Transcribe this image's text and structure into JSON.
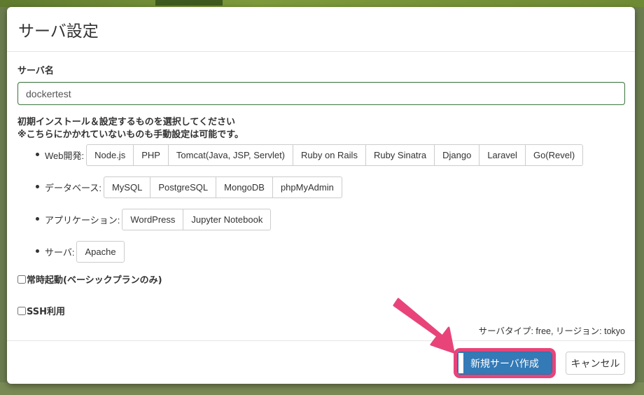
{
  "dialog": {
    "title": "サーバ設定"
  },
  "server_name": {
    "label": "サーバ名",
    "value": "dockertest"
  },
  "install": {
    "heading": "初期インストール＆設定するものを選択してください",
    "note": "※こちらにかかれていないものも手動設定は可能です。",
    "categories": [
      {
        "label": "Web開発:",
        "options": [
          "Node.js",
          "PHP",
          "Tomcat(Java, JSP, Servlet)",
          "Ruby on Rails",
          "Ruby Sinatra",
          "Django",
          "Laravel",
          "Go(Revel)"
        ]
      },
      {
        "label": "データベース:",
        "options": [
          "MySQL",
          "PostgreSQL",
          "MongoDB",
          "phpMyAdmin"
        ]
      },
      {
        "label": "アプリケーション:",
        "options": [
          "WordPress",
          "Jupyter Notebook"
        ]
      },
      {
        "label": "サーバ:",
        "options": [
          "Apache"
        ]
      }
    ]
  },
  "checkboxes": {
    "always_on": {
      "label": "常時起動(ベーシックプランのみ)",
      "checked": false
    },
    "ssh": {
      "label": "SSH利用",
      "checked": false
    }
  },
  "server_meta": "サーバタイプ: free, リージョン: tokyo",
  "footer": {
    "create_label": "新規サーバ作成",
    "cancel_label": "キャンセル"
  },
  "colors": {
    "primary": "#337ab7",
    "highlight": "#e8447a",
    "input_border": "#3c763d"
  }
}
